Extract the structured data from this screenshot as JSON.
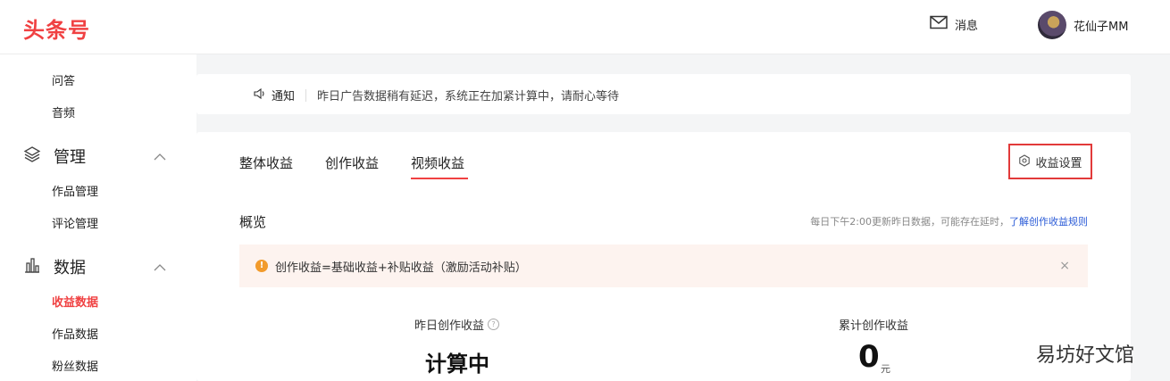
{
  "header": {
    "logo": "头条号",
    "messages_label": "消息",
    "user_name": "花仙子MM"
  },
  "sidebar": {
    "items_top": [
      "问答",
      "音频"
    ],
    "groups": [
      {
        "label": "管理",
        "icon": "layers-icon",
        "items": [
          "作品管理",
          "评论管理"
        ]
      },
      {
        "label": "数据",
        "icon": "bar-chart-icon",
        "items": [
          "收益数据",
          "作品数据",
          "粉丝数据"
        ]
      }
    ],
    "active_item": "收益数据"
  },
  "notice": {
    "title": "通知",
    "text": "昨日广告数据稍有延迟，系统正在加紧计算中，请耐心等待"
  },
  "tabs": {
    "items": [
      "整体收益",
      "创作收益",
      "视频收益"
    ],
    "active": "视频收益"
  },
  "settings_label": "收益设置",
  "overview": {
    "title": "概览",
    "update_note": "每日下午2:00更新昨日数据，可能存在延时，",
    "rules_link": "了解创作收益规则"
  },
  "alert": {
    "text": "创作收益=基础收益+补贴收益（激励活动补贴）",
    "icon_text": "!",
    "close": "×"
  },
  "stats": {
    "yesterday_label": "昨日创作收益",
    "yesterday_value": "计算中",
    "total_label": "累计创作收益",
    "total_value": "0",
    "total_unit": "元"
  },
  "watermark": "易坊好文馆",
  "colors": {
    "accent": "#f04142",
    "highlight_border": "#e23a3a",
    "alert_bg": "#fdf3ef",
    "alert_icon": "#f29b2c",
    "link": "#2a5bd7"
  }
}
